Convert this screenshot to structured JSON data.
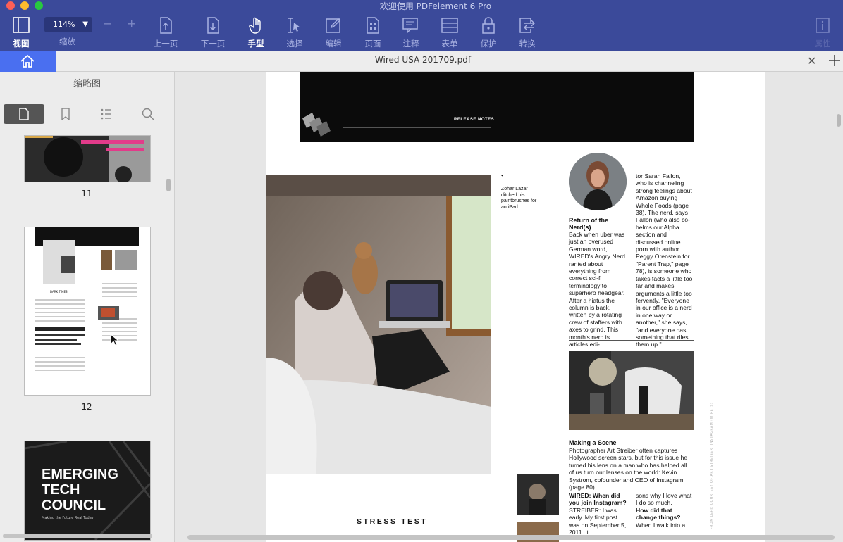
{
  "window": {
    "title": "欢迎使用 PDFelement 6 Pro"
  },
  "toolbar": {
    "view_label": "视图",
    "zoom_value": "114%",
    "zoom_label": "缩放",
    "zoom_out": "−",
    "zoom_in": "+",
    "prev_label": "上一页",
    "next_label": "下一页",
    "hand_label": "手型",
    "select_label": "选择",
    "edit_label": "编辑",
    "page_label": "页面",
    "comment_label": "注释",
    "form_label": "表单",
    "protect_label": "保护",
    "convert_label": "转换",
    "info_label": "属性"
  },
  "tab": {
    "title": "Wired USA 201709.pdf"
  },
  "sidebar": {
    "title": "缩略图",
    "pages": [
      "11",
      "12"
    ],
    "thumb13": {
      "line1": "EMERGING",
      "line2": "TECH",
      "line3": "COUNCIL",
      "tagline": "Making the Future Real Today"
    }
  },
  "document": {
    "release_notes": "RELEASE NOTES",
    "caption": "Zohar Lazar ditched his paintbrushes for an iPad.",
    "return_title": "Return of the Nerd(s)",
    "return_body": "Back when uber was just an overused German word, WIRED's Angry Nerd ranted about everything from correct sci-fi terminology to superhero headgear. After a hiatus the column is back, written by a rotating crew of staffers with axes to grind. This month's nerd is articles edi-",
    "col2_body": "tor Sarah Fallon, who is channeling strong feelings about Amazon buying Whole Foods (page 38). The nerd, says Fallon (who also co-helms our Alpha section and discussed online porn with author Peggy Orenstein for \"Parent Trap,\" page 78), is someone who takes facts a little too far and makes arguments a little too fervently. \"Everyone in our office is a nerd in one way or another,\" she says, \"and everyone has something that riles them up.\"",
    "scene_title": "Making a Scene",
    "scene_body": "Photographer Art Streiber often captures Hollywood screen stars, but for this issue he turned his lens on a man who has helped all of us turn our lenses on the world: Kevin Systrom, cofounder and CEO of Instagram (page 80).",
    "q1": "WIRED: When did you join Instagram?",
    "a1": "STREIBER: I was early. My first post was on September 5, 2011. It",
    "q2_pre": "sons why I love what I do so much.",
    "q2": "How did that change things?",
    "a2": "When I walk into a",
    "stress_test": "STRESS TEST",
    "vertical_credit": "FROM LEFT: COURTESY OF ART STREIBER (INSTAGRAM (WIRETS)"
  },
  "colors": {
    "toolbar": "#3b4a9a",
    "accent": "#4a6ff0"
  }
}
